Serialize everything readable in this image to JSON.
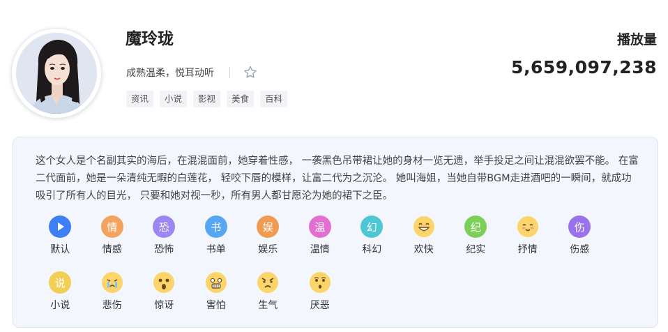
{
  "profile": {
    "name": "魔玲珑",
    "tagline": "成熟温柔，悦耳动听",
    "tags": [
      "资讯",
      "小说",
      "影视",
      "美食",
      "百科"
    ]
  },
  "stats": {
    "plays_label": "播放量",
    "plays_value": "5,659,097,238"
  },
  "description": "这个女人是个名副其实的海后，在混混面前，她穿着性感， 一袭黑色吊带裙让她的身材一览无遗，举手投足之间让混混欲罢不能。 在富二代面前，她是一朵清纯无暇的白莲花， 轻咬下唇的模样，让富二代为之沉沦。 她叫海姐，当她自带BGM走进酒吧的一瞬间，就成功吸引了所有人的目光， 只要和她对视一秒，所有男人都甘愿沦为她的裙下之臣。",
  "emotions": [
    {
      "label": "默认",
      "glyph": "",
      "icon": "play-icon",
      "color": "#3d7ff5",
      "kind": "play"
    },
    {
      "label": "情感",
      "glyph": "情",
      "icon": "emotion-icon",
      "color": "#f3a35e",
      "kind": "char"
    },
    {
      "label": "恐怖",
      "glyph": "恐",
      "icon": "horror-icon",
      "color": "#9b86f2",
      "kind": "char"
    },
    {
      "label": "书单",
      "glyph": "书",
      "icon": "booklist-icon",
      "color": "#56a6f2",
      "kind": "char"
    },
    {
      "label": "娱乐",
      "glyph": "娱",
      "icon": "entertainment-icon",
      "color": "#f09a52",
      "kind": "char"
    },
    {
      "label": "温情",
      "glyph": "温",
      "icon": "warmth-icon",
      "color": "#e46fd2",
      "kind": "char"
    },
    {
      "label": "科幻",
      "glyph": "幻",
      "icon": "scifi-icon",
      "color": "#4fc6d3",
      "kind": "char"
    },
    {
      "label": "欢快",
      "glyph": "",
      "icon": "laughing-face-icon",
      "color": "#fbd46a",
      "kind": "face",
      "face": "laugh"
    },
    {
      "label": "纪实",
      "glyph": "纪",
      "icon": "documentary-icon",
      "color": "#7ccf58",
      "kind": "char"
    },
    {
      "label": "抒情",
      "glyph": "",
      "icon": "content-face-icon",
      "color": "#fbd46a",
      "kind": "face",
      "face": "content"
    },
    {
      "label": "伤感",
      "glyph": "伤",
      "icon": "sad-icon",
      "color": "#9a72ee",
      "kind": "char"
    },
    {
      "label": "小说",
      "glyph": "说",
      "icon": "novel-icon",
      "color": "#f1cf55",
      "kind": "char"
    },
    {
      "label": "悲伤",
      "glyph": "",
      "icon": "crying-face-icon",
      "color": "#fbd46a",
      "kind": "face",
      "face": "cry"
    },
    {
      "label": "惊讶",
      "glyph": "",
      "icon": "surprised-face-icon",
      "color": "#fbd46a",
      "kind": "face",
      "face": "surprise"
    },
    {
      "label": "害怕",
      "glyph": "",
      "icon": "scared-face-icon",
      "color": "#fbd46a",
      "kind": "face",
      "face": "scared"
    },
    {
      "label": "生气",
      "glyph": "",
      "icon": "angry-face-icon",
      "color": "#fbd46a",
      "kind": "face",
      "face": "angry"
    },
    {
      "label": "厌恶",
      "glyph": "",
      "icon": "disgust-face-icon",
      "color": "#fbd46a",
      "kind": "face",
      "face": "disgust"
    }
  ]
}
